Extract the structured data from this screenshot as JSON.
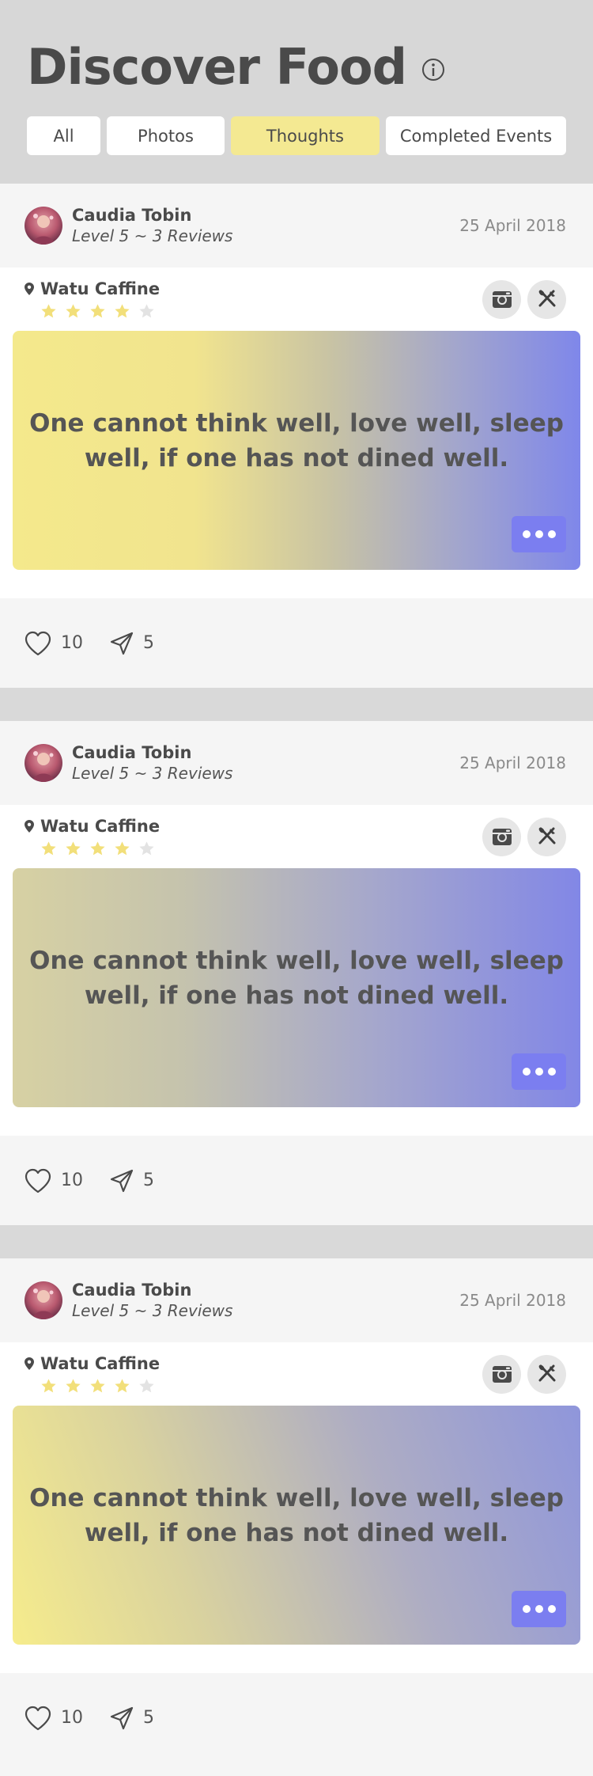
{
  "header": {
    "title": "Discover Food",
    "tabs": [
      {
        "label": "All",
        "active": false
      },
      {
        "label": "Photos",
        "active": false
      },
      {
        "label": "Thoughts",
        "active": true
      },
      {
        "label": "Completed Events",
        "active": false
      }
    ]
  },
  "colors": {
    "accent_yellow": "#f4e992",
    "accent_purple": "#7b7ef0",
    "star_filled": "#f2df7a",
    "star_empty": "#e3e3e3"
  },
  "posts": [
    {
      "user_name": "Caudia Tobin",
      "user_level": "Level 5 ~ 3 Reviews",
      "date": "25 April 2018",
      "place": "Watu Caffine",
      "rating": 4,
      "rating_max": 5,
      "quote": "One cannot think well, love well, sleep well, if one has not dined well.",
      "likes": "10",
      "shares": "5",
      "icons": [
        "instagram-icon",
        "utensils-icon",
        "heart-icon",
        "send-icon",
        "more-icon"
      ]
    },
    {
      "user_name": "Caudia Tobin",
      "user_level": "Level 5 ~ 3 Reviews",
      "date": "25 April 2018",
      "place": "Watu Caffine",
      "rating": 4,
      "rating_max": 5,
      "quote": "One cannot think well, love well, sleep well, if one has not dined well.",
      "likes": "10",
      "shares": "5",
      "icons": [
        "instagram-icon",
        "utensils-icon",
        "heart-icon",
        "send-icon",
        "more-icon"
      ]
    },
    {
      "user_name": "Caudia Tobin",
      "user_level": "Level 5 ~ 3 Reviews",
      "date": "25 April 2018",
      "place": "Watu Caffine",
      "rating": 4,
      "rating_max": 5,
      "quote": "One cannot think well, love well, sleep well, if one has not dined well.",
      "likes": "10",
      "shares": "5",
      "icons": [
        "instagram-icon",
        "utensils-icon",
        "heart-icon",
        "send-icon",
        "more-icon"
      ]
    }
  ]
}
